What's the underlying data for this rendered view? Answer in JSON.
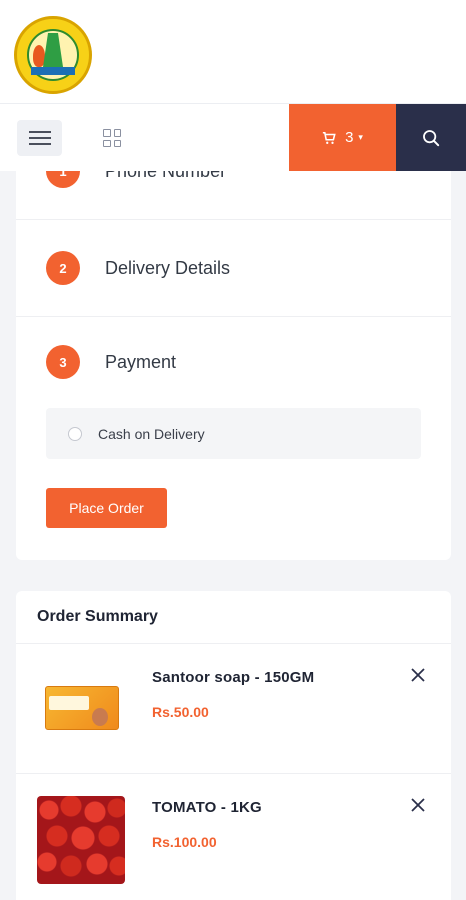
{
  "header": {
    "logo_icon": "temple-emblem-logo",
    "menu_icon": "hamburger-icon",
    "grid_icon": "grid-view-icon",
    "cart": {
      "icon": "cart-icon",
      "count": "3",
      "chevron": "chevron-down-icon"
    },
    "search_icon": "search-icon"
  },
  "checkout": {
    "steps": [
      {
        "number": "1",
        "label": "Phone Number"
      },
      {
        "number": "2",
        "label": "Delivery Details"
      },
      {
        "number": "3",
        "label": "Payment"
      }
    ],
    "payment_option": "Cash on Delivery",
    "place_order_label": "Place Order"
  },
  "summary": {
    "title": "Order Summary",
    "items": [
      {
        "name": "Santoor soap - 150GM",
        "price": "Rs.50.00",
        "image": "santoor-soap-image"
      },
      {
        "name": "TOMATO - 1KG",
        "price": "Rs.100.00",
        "image": "tomato-image"
      }
    ]
  },
  "colors": {
    "accent": "#f26230",
    "dark": "#2a2f4a"
  }
}
